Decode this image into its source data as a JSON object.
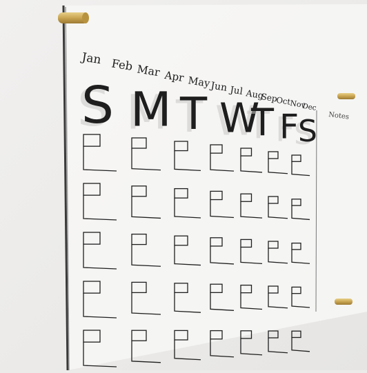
{
  "calendar": {
    "months": [
      "Jan",
      "Feb",
      "Mar",
      "Apr",
      "May",
      "Jun",
      "Jul",
      "Aug",
      "Sep",
      "Oct",
      "Nov",
      "Dec"
    ],
    "days": [
      "S",
      "M",
      "T",
      "W",
      "T",
      "F",
      "S"
    ],
    "notes_label": "Notes",
    "week_rows": 5
  },
  "colors": {
    "wall": "#ecebea",
    "acrylic": "#f6f6f5",
    "ink": "#1e1e1e",
    "brass": "#c9a552"
  }
}
